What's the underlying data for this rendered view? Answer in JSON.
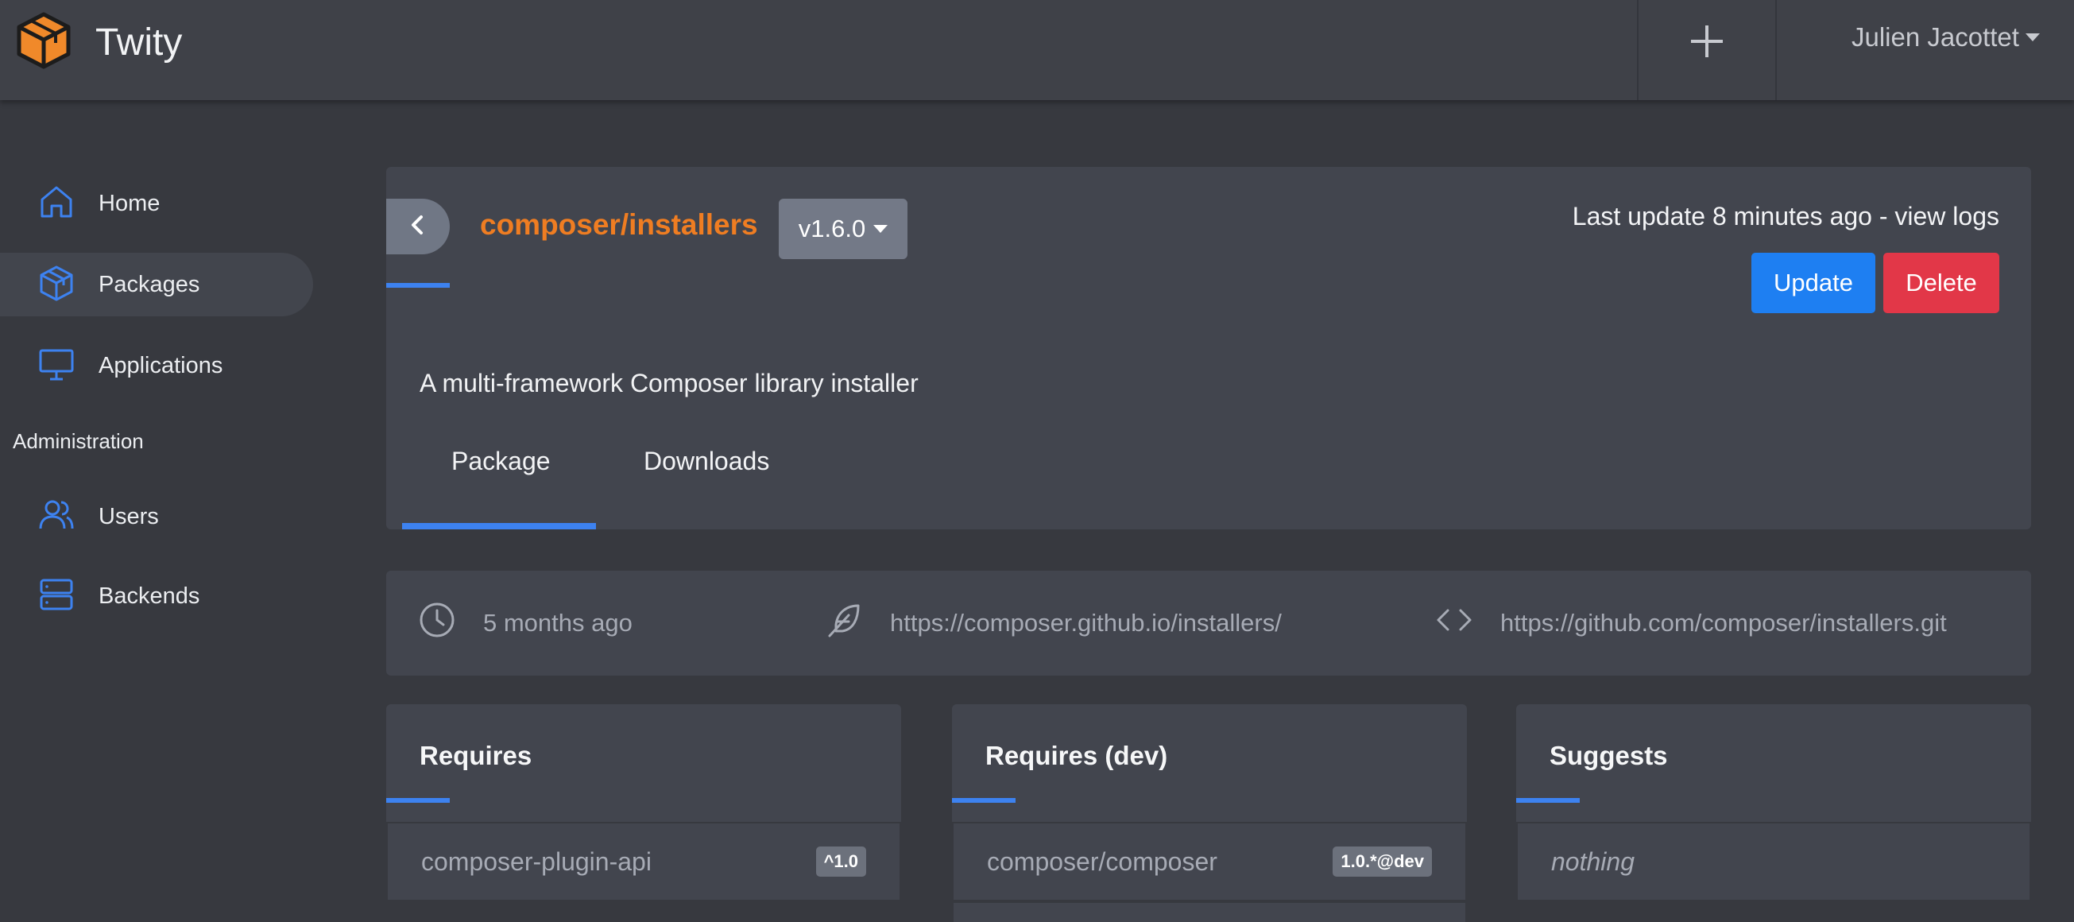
{
  "app": {
    "name": "Twity"
  },
  "user": {
    "name": "Julien Jacottet"
  },
  "sidebar": {
    "items": [
      {
        "label": "Home",
        "icon": "home-icon"
      },
      {
        "label": "Packages",
        "icon": "box-icon"
      },
      {
        "label": "Applications",
        "icon": "monitor-icon"
      }
    ],
    "section": "Administration",
    "admin_items": [
      {
        "label": "Users",
        "icon": "users-icon"
      },
      {
        "label": "Backends",
        "icon": "server-icon"
      }
    ]
  },
  "package": {
    "name": "composer/installers",
    "version": "v1.6.0",
    "last_update_prefix": "Last update 8 minutes ago - ",
    "view_logs": "view logs",
    "update_label": "Update",
    "delete_label": "Delete",
    "description": "A multi-framework Composer library installer",
    "tabs": [
      "Package",
      "Downloads"
    ],
    "active_tab": "Package"
  },
  "meta": {
    "time": "5 months ago",
    "homepage": "https://composer.github.io/installers/",
    "repository": "https://github.com/composer/installers.git"
  },
  "requires": {
    "title": "Requires",
    "items": [
      {
        "name": "composer-plugin-api",
        "version": "^1.0"
      }
    ]
  },
  "requires_dev": {
    "title": "Requires (dev)",
    "items": [
      {
        "name": "composer/composer",
        "version": "1.0.*@dev"
      }
    ]
  },
  "suggests": {
    "title": "Suggests",
    "empty": "nothing"
  },
  "colors": {
    "accent": "#3d82f0",
    "package_name": "#ef7d22",
    "update": "#1e7ff2",
    "delete": "#e23748",
    "logo": "#f0892a"
  }
}
